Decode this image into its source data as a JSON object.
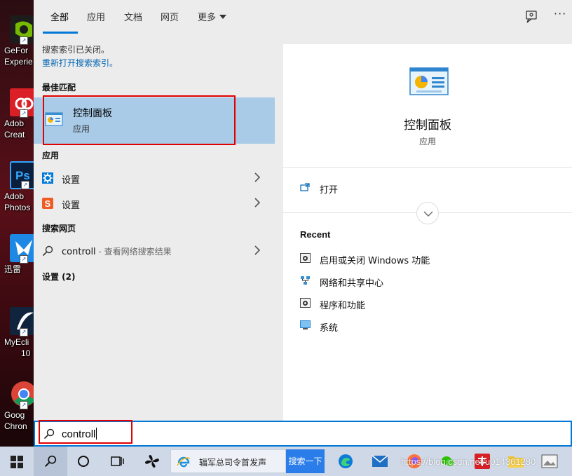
{
  "desktop": {
    "icons": [
      {
        "label1": "GeFor",
        "label2": "Experie"
      },
      {
        "label1": "Adob",
        "label2": "Creat"
      },
      {
        "label1": "Adob",
        "label2": "Photos"
      },
      {
        "label1": "迅雷",
        "label2": ""
      },
      {
        "label1": "MyEcli",
        "label2": "10"
      },
      {
        "label1": "Goog",
        "label2": "Chron"
      }
    ]
  },
  "tabs": [
    {
      "label": "全部"
    },
    {
      "label": "应用"
    },
    {
      "label": "文档"
    },
    {
      "label": "网页"
    },
    {
      "label": "更多"
    }
  ],
  "notice": {
    "text": "搜索索引已关闭。",
    "link": "重新打开搜索索引。"
  },
  "best_match": {
    "heading": "最佳匹配",
    "title": "控制面板",
    "subtitle": "应用"
  },
  "apps": {
    "heading": "应用",
    "items": [
      {
        "label": "设置",
        "icon": "gear-icon"
      },
      {
        "label": "设置",
        "icon": "sogou-settings-icon"
      }
    ]
  },
  "web": {
    "heading": "搜索网页",
    "query": "controll",
    "hint": " - 查看网络搜索结果"
  },
  "settings_section": {
    "heading": "设置 (2)"
  },
  "preview": {
    "title": "控制面板",
    "subtitle": "应用",
    "open_label": "打开",
    "recent_heading": "Recent",
    "recent": [
      {
        "label": "启用或关闭 Windows 功能"
      },
      {
        "label": "网络和共享中心"
      },
      {
        "label": "程序和功能"
      },
      {
        "label": "系统"
      }
    ]
  },
  "search": {
    "value": "controll"
  },
  "taskbar": {
    "news_text": "辐军总司令首发声",
    "search_button": "搜索一下"
  },
  "watermark": "https://blog.csdn.net/u014361280",
  "colors": {
    "accent": "#0078d7",
    "selection": "#a9cbe8",
    "highlight_box": "#e00000"
  }
}
